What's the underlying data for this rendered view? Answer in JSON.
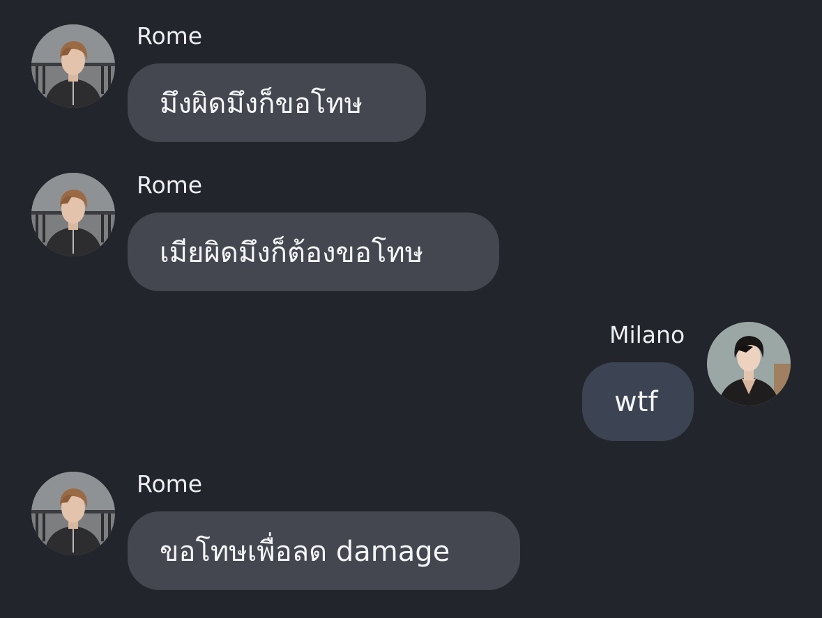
{
  "colors": {
    "background": "#22252b",
    "bubble_incoming": "#44474f",
    "bubble_outgoing": "#3c4453",
    "text": "#f4f5f7"
  },
  "messages": [
    {
      "sender": "Rome",
      "text": "มึงผิดมึงก็ขอโทษ",
      "direction": "incoming",
      "avatar": "rome-avatar-icon"
    },
    {
      "sender": "Rome",
      "text": "เมียผิดมึงก็ต้องขอโทษ",
      "direction": "incoming",
      "avatar": "rome-avatar-icon"
    },
    {
      "sender": "Milano",
      "text": "wtf",
      "direction": "outgoing",
      "avatar": "milano-avatar-icon"
    },
    {
      "sender": "Rome",
      "text": "ขอโทษเพื่อลด damage",
      "direction": "incoming",
      "avatar": "rome-avatar-icon"
    }
  ]
}
